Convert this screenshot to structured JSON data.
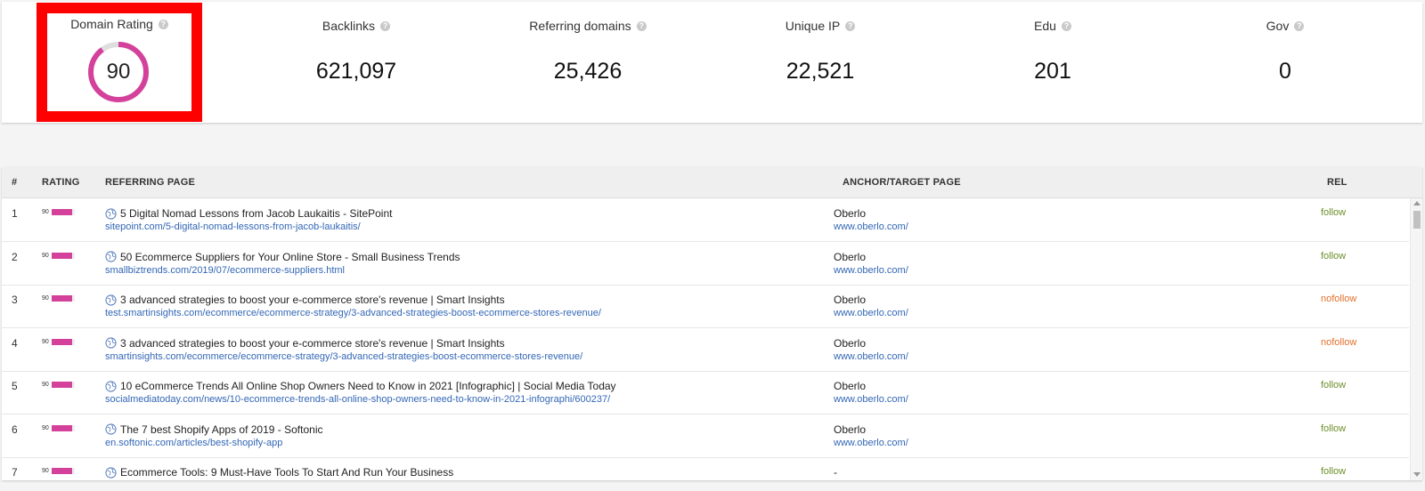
{
  "metrics": {
    "domain_rating": {
      "label": "Domain Rating",
      "value": "90",
      "gauge_fraction": 0.9,
      "color": "#d4419b"
    },
    "backlinks": {
      "label": "Backlinks",
      "value": "621,097"
    },
    "referring_domains": {
      "label": "Referring domains",
      "value": "25,426"
    },
    "unique_ip": {
      "label": "Unique IP",
      "value": "22,521"
    },
    "edu": {
      "label": "Edu",
      "value": "201"
    },
    "gov": {
      "label": "Gov",
      "value": "0"
    },
    "help_icon": "question-circle-icon"
  },
  "table": {
    "headers": {
      "num": "#",
      "rating": "RATING",
      "referring_page": "REFERRING PAGE",
      "anchor_target": "ANCHOR/TARGET PAGE",
      "rel": "REL"
    },
    "rows": [
      {
        "num": "1",
        "rating": "90",
        "rating_fraction": 0.9,
        "title": "5 Digital Nomad Lessons from Jacob Laukaitis - SitePoint",
        "url": "sitepoint.com/5-digital-nomad-lessons-from-jacob-laukaitis/",
        "anchor": "Oberlo",
        "target": "www.oberlo.com/",
        "rel": "follow"
      },
      {
        "num": "2",
        "rating": "90",
        "rating_fraction": 0.9,
        "title": "50 Ecommerce Suppliers for Your Online Store - Small Business Trends",
        "url": "smallbiztrends.com/2019/07/ecommerce-suppliers.html",
        "anchor": "Oberlo",
        "target": "www.oberlo.com/",
        "rel": "follow"
      },
      {
        "num": "3",
        "rating": "90",
        "rating_fraction": 0.9,
        "title": "3 advanced strategies to boost your e-commerce store's revenue | Smart Insights",
        "url": "test.smartinsights.com/ecommerce/ecommerce-strategy/3-advanced-strategies-boost-ecommerce-stores-revenue/",
        "anchor": "Oberlo",
        "target": "www.oberlo.com/",
        "rel": "nofollow"
      },
      {
        "num": "4",
        "rating": "90",
        "rating_fraction": 0.9,
        "title": "3 advanced strategies to boost your e-commerce store's revenue | Smart Insights",
        "url": "smartinsights.com/ecommerce/ecommerce-strategy/3-advanced-strategies-boost-ecommerce-stores-revenue/",
        "anchor": "Oberlo",
        "target": "www.oberlo.com/",
        "rel": "nofollow"
      },
      {
        "num": "5",
        "rating": "90",
        "rating_fraction": 0.9,
        "title": "10 eCommerce Trends All Online Shop Owners Need to Know in 2021 [Infographic] | Social Media Today",
        "url": "socialmediatoday.com/news/10-ecommerce-trends-all-online-shop-owners-need-to-know-in-2021-infographi/600237/",
        "anchor": "Oberlo",
        "target": "www.oberlo.com/",
        "rel": "follow"
      },
      {
        "num": "6",
        "rating": "90",
        "rating_fraction": 0.9,
        "title": "The 7 best Shopify Apps of 2019 - Softonic",
        "url": "en.softonic.com/articles/best-shopify-app",
        "anchor": "Oberlo",
        "target": "www.oberlo.com/",
        "rel": "follow"
      },
      {
        "num": "7",
        "rating": "90",
        "rating_fraction": 0.9,
        "title": "Ecommerce Tools: 9 Must-Have Tools To Start And Run Your Business",
        "url": "",
        "anchor": "-",
        "target": "",
        "rel": "follow"
      }
    ]
  },
  "colors": {
    "follow": "#6d8f2a",
    "nofollow": "#e2702c",
    "link": "#3367b5",
    "highlight": "#ff0000"
  }
}
